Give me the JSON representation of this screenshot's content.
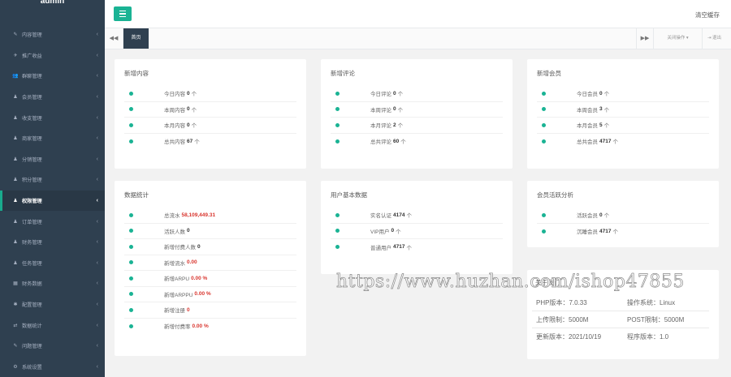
{
  "sidebar": {
    "brand": "admin",
    "items": [
      {
        "label": "内容管理",
        "icon": "✎",
        "active": false
      },
      {
        "label": "推广收益",
        "icon": "✈",
        "active": false
      },
      {
        "label": "群聊管理",
        "icon": "👥",
        "active": false
      },
      {
        "label": "会员管理",
        "icon": "♟",
        "active": false
      },
      {
        "label": "收支管理",
        "icon": "♟",
        "active": false
      },
      {
        "label": "商家管理",
        "icon": "♟",
        "active": false
      },
      {
        "label": "分销管理",
        "icon": "♟",
        "active": false
      },
      {
        "label": "积分管理",
        "icon": "♟",
        "active": false
      },
      {
        "label": "权限管理",
        "icon": "♟",
        "active": true
      },
      {
        "label": "订单管理",
        "icon": "♟",
        "active": false
      },
      {
        "label": "财务管理",
        "icon": "♟",
        "active": false
      },
      {
        "label": "任务管理",
        "icon": "♟",
        "active": false
      },
      {
        "label": "财务数据",
        "icon": "▦",
        "active": false
      },
      {
        "label": "配置管理",
        "icon": "✱",
        "active": false
      },
      {
        "label": "数据统计",
        "icon": "⇄",
        "active": false
      },
      {
        "label": "问题管理",
        "icon": "✎",
        "active": false
      },
      {
        "label": "系统设置",
        "icon": "⚙",
        "active": false
      }
    ]
  },
  "topbar": {
    "menu_icon": "hamburger-icon",
    "clear_cache": "清空缓存"
  },
  "tabs": {
    "left_arrow": "◀◀",
    "home": "首页",
    "right_arrow": "▶▶",
    "close_ops": "关闭操作 ▾",
    "logout": "⇥ 退出"
  },
  "panels": {
    "new_content": {
      "title": "新增内容",
      "rows": [
        {
          "label": "今日内容",
          "value": "0",
          "unit": "个"
        },
        {
          "label": "本周内容",
          "value": "0",
          "unit": "个"
        },
        {
          "label": "本月内容",
          "value": "0",
          "unit": "个"
        },
        {
          "label": "总共内容",
          "value": "67",
          "unit": "个"
        }
      ]
    },
    "new_comments": {
      "title": "新增评论",
      "rows": [
        {
          "label": "今日评论",
          "value": "0",
          "unit": "个"
        },
        {
          "label": "本周评论",
          "value": "0",
          "unit": "个"
        },
        {
          "label": "本月评论",
          "value": "2",
          "unit": "个"
        },
        {
          "label": "总共评论",
          "value": "60",
          "unit": "个"
        }
      ]
    },
    "new_members": {
      "title": "新增会员",
      "rows": [
        {
          "label": "今日会员",
          "value": "0",
          "unit": "个"
        },
        {
          "label": "本周会员",
          "value": "3",
          "unit": "个"
        },
        {
          "label": "本月会员",
          "value": "5",
          "unit": "个"
        },
        {
          "label": "总共会员",
          "value": "4717",
          "unit": "个"
        }
      ]
    },
    "data_stats": {
      "title": "数据统计",
      "rows": [
        {
          "label": "总流水",
          "value": "58,109,449.31"
        },
        {
          "label": "活跃人数",
          "value": "0"
        },
        {
          "label": "新增付费人数",
          "value": "0"
        },
        {
          "label": "新增流水",
          "value": "0.00"
        },
        {
          "label": "新增ARPU",
          "value": "0.00 %"
        },
        {
          "label": "新增ARPPU",
          "value": "0.00 %"
        },
        {
          "label": "新增注册",
          "value": "0"
        },
        {
          "label": "新增付费率",
          "value": "0.00 %"
        }
      ]
    },
    "user_types": {
      "title": "用户基本数据",
      "rows": [
        {
          "label": "实名认证",
          "value": "4174",
          "unit": "个"
        },
        {
          "label": "VIP用户",
          "value": "0",
          "unit": "个"
        },
        {
          "label": "普通用户",
          "value": "4717",
          "unit": "个"
        }
      ]
    },
    "member_analysis": {
      "title": "会员活跃分析",
      "rows": [
        {
          "label": "活跃会员",
          "value": "0",
          "unit": "个"
        },
        {
          "label": "沉睡会员",
          "value": "4717",
          "unit": "个"
        }
      ]
    },
    "system_info": {
      "title": "关于我们",
      "rows": [
        [
          "PHP版本：7.0.33",
          "操作系统：Linux"
        ],
        [
          "上传限制：5000M",
          "POST限制：5000M"
        ],
        [
          "更新版本：2021/10/19",
          "程序版本：1.0"
        ]
      ]
    }
  },
  "watermark": "https://www.huzhan.com/ishop47855"
}
